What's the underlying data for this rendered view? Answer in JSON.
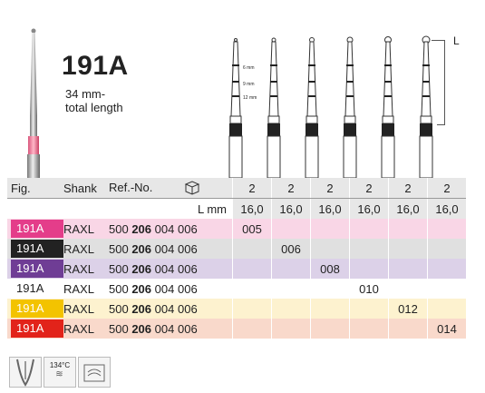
{
  "product": {
    "title": "191A",
    "subtitle_line1": "34 mm-",
    "subtitle_line2": "total length"
  },
  "diagram": {
    "marks": [
      "6 mm",
      "9 mm",
      "12 mm"
    ],
    "length_label": "L"
  },
  "table": {
    "headers": {
      "fig": "Fig.",
      "shank": "Shank",
      "ref": "Ref.-No."
    },
    "count_label": "2",
    "length_row_label": "L mm",
    "lengths": [
      "16,0",
      "16,0",
      "16,0",
      "16,0",
      "16,0",
      "16,0"
    ],
    "counts": [
      "2",
      "2",
      "2",
      "2",
      "2",
      "2"
    ],
    "rows": [
      {
        "fig": "191A",
        "shank": "RAXL",
        "ref_a": "500",
        "ref_b": "206",
        "ref_c": "004",
        "ref_d": "006",
        "size": "005",
        "chip": "#e43d8a",
        "tint": "#f9d6e6",
        "col": 0
      },
      {
        "fig": "191A",
        "shank": "RAXL",
        "ref_a": "500",
        "ref_b": "206",
        "ref_c": "004",
        "ref_d": "006",
        "size": "006",
        "chip": "#222222",
        "tint": "#e0e0e0",
        "col": 1
      },
      {
        "fig": "191A",
        "shank": "RAXL",
        "ref_a": "500",
        "ref_b": "206",
        "ref_c": "004",
        "ref_d": "006",
        "size": "008",
        "chip": "#6f3d95",
        "tint": "#dcd1e8",
        "col": 2
      },
      {
        "fig": "191A",
        "shank": "RAXL",
        "ref_a": "500",
        "ref_b": "206",
        "ref_c": "004",
        "ref_d": "006",
        "size": "010",
        "chip": "#ffffff",
        "tint": "#ffffff",
        "col": 3
      },
      {
        "fig": "191A",
        "shank": "RAXL",
        "ref_a": "500",
        "ref_b": "206",
        "ref_c": "004",
        "ref_d": "006",
        "size": "012",
        "chip": "#f3c300",
        "tint": "#fdf2cf",
        "col": 4
      },
      {
        "fig": "191A",
        "shank": "RAXL",
        "ref_a": "500",
        "ref_b": "206",
        "ref_c": "004",
        "ref_d": "006",
        "size": "014",
        "chip": "#e2231a",
        "tint": "#f9d9cb",
        "col": 5
      }
    ]
  },
  "icons": {
    "sterilize_text": "134°C"
  }
}
